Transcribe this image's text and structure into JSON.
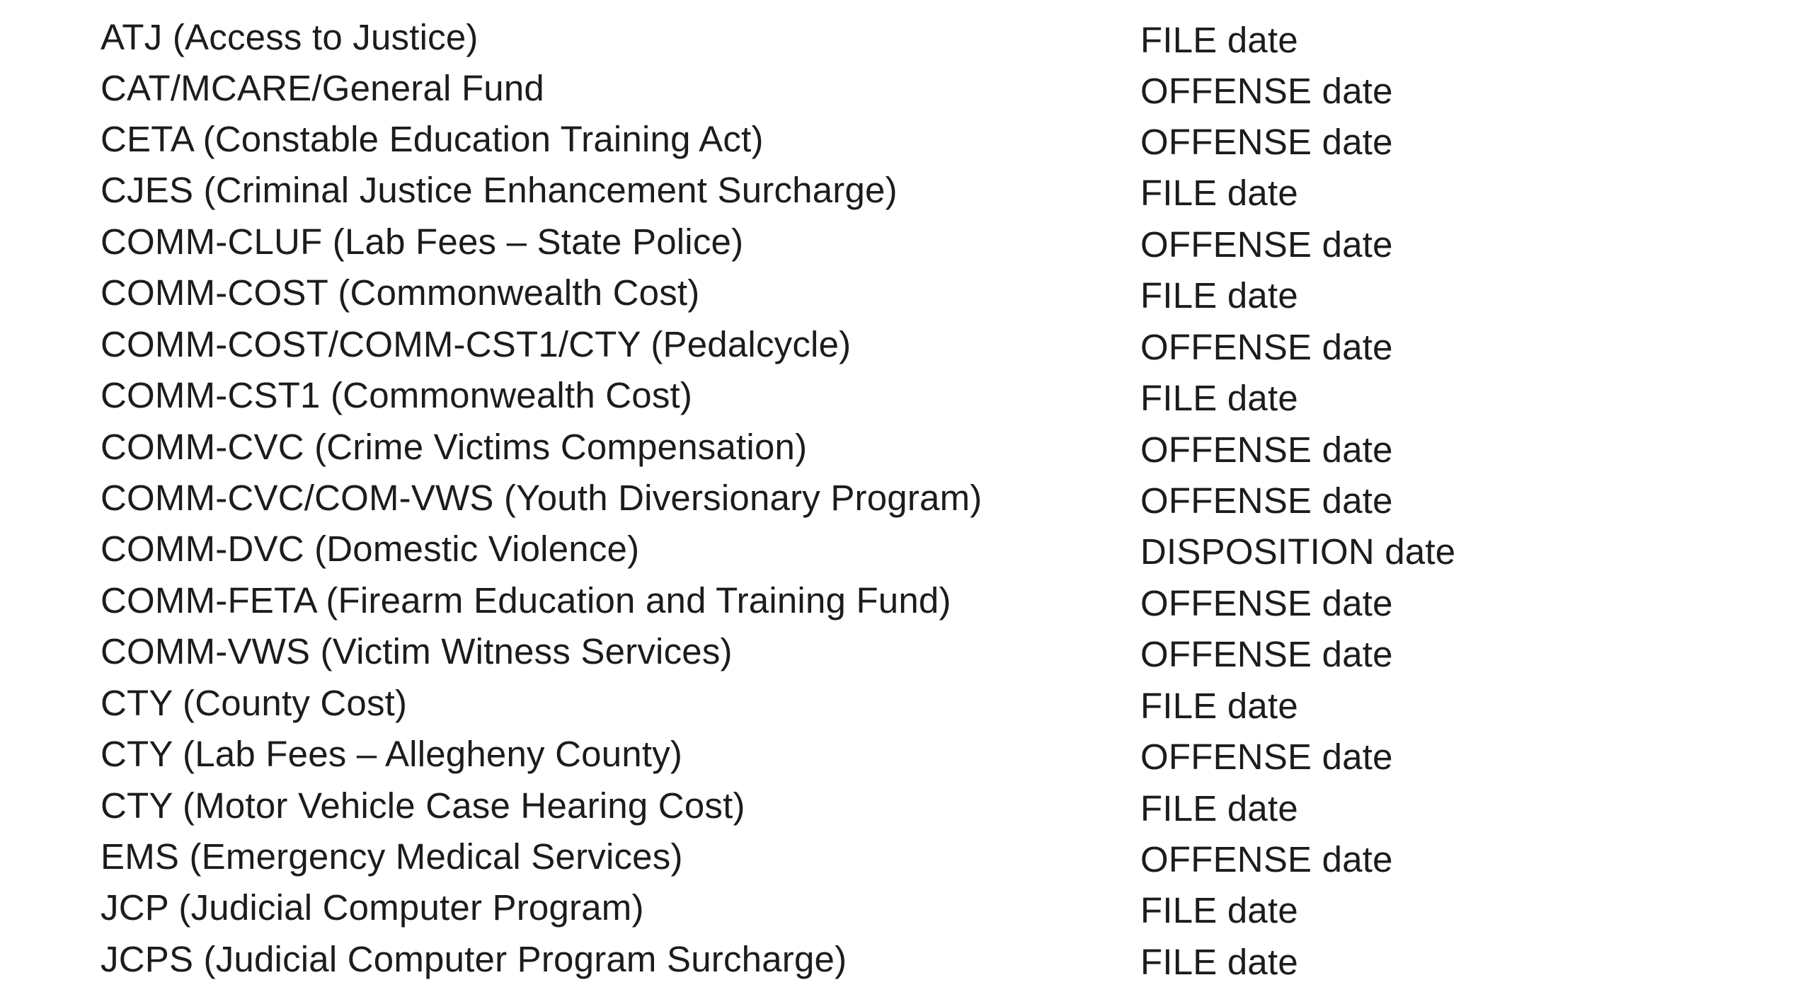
{
  "fees": [
    {
      "name": "ATJ (Access to Justice)",
      "date_basis": "FILE date"
    },
    {
      "name": "CAT/MCARE/General Fund",
      "date_basis": "OFFENSE date"
    },
    {
      "name": "CETA (Constable Education Training Act)",
      "date_basis": "OFFENSE date"
    },
    {
      "name": "CJES (Criminal Justice Enhancement Surcharge)",
      "date_basis": "FILE date"
    },
    {
      "name": "COMM-CLUF (Lab Fees – State Police)",
      "date_basis": "OFFENSE date"
    },
    {
      "name": "COMM-COST (Commonwealth Cost)",
      "date_basis": "FILE date"
    },
    {
      "name": "COMM-COST/COMM-CST1/CTY (Pedalcycle)",
      "date_basis": "OFFENSE date"
    },
    {
      "name": "COMM-CST1 (Commonwealth Cost)",
      "date_basis": "FILE date"
    },
    {
      "name": "COMM-CVC (Crime Victims Compensation)",
      "date_basis": "OFFENSE date"
    },
    {
      "name": "COMM-CVC/COM-VWS (Youth Diversionary Program)",
      "date_basis": "OFFENSE date"
    },
    {
      "name": "COMM-DVC (Domestic Violence)",
      "date_basis": "DISPOSITION date"
    },
    {
      "name": "COMM-FETA (Firearm Education and Training Fund)",
      "date_basis": "OFFENSE date"
    },
    {
      "name": "COMM-VWS (Victim Witness Services)",
      "date_basis": "OFFENSE date"
    },
    {
      "name": "CTY (County Cost)",
      "date_basis": "FILE date"
    },
    {
      "name": "CTY (Lab Fees – Allegheny County)",
      "date_basis": "OFFENSE date"
    },
    {
      "name": "CTY (Motor Vehicle Case Hearing Cost)",
      "date_basis": "FILE date"
    },
    {
      "name": "EMS (Emergency Medical Services)",
      "date_basis": "OFFENSE date"
    },
    {
      "name": "JCP (Judicial Computer Program)",
      "date_basis": "FILE date"
    },
    {
      "name": "JCPS (Judicial Computer Program Surcharge)",
      "date_basis": "FILE date"
    }
  ]
}
